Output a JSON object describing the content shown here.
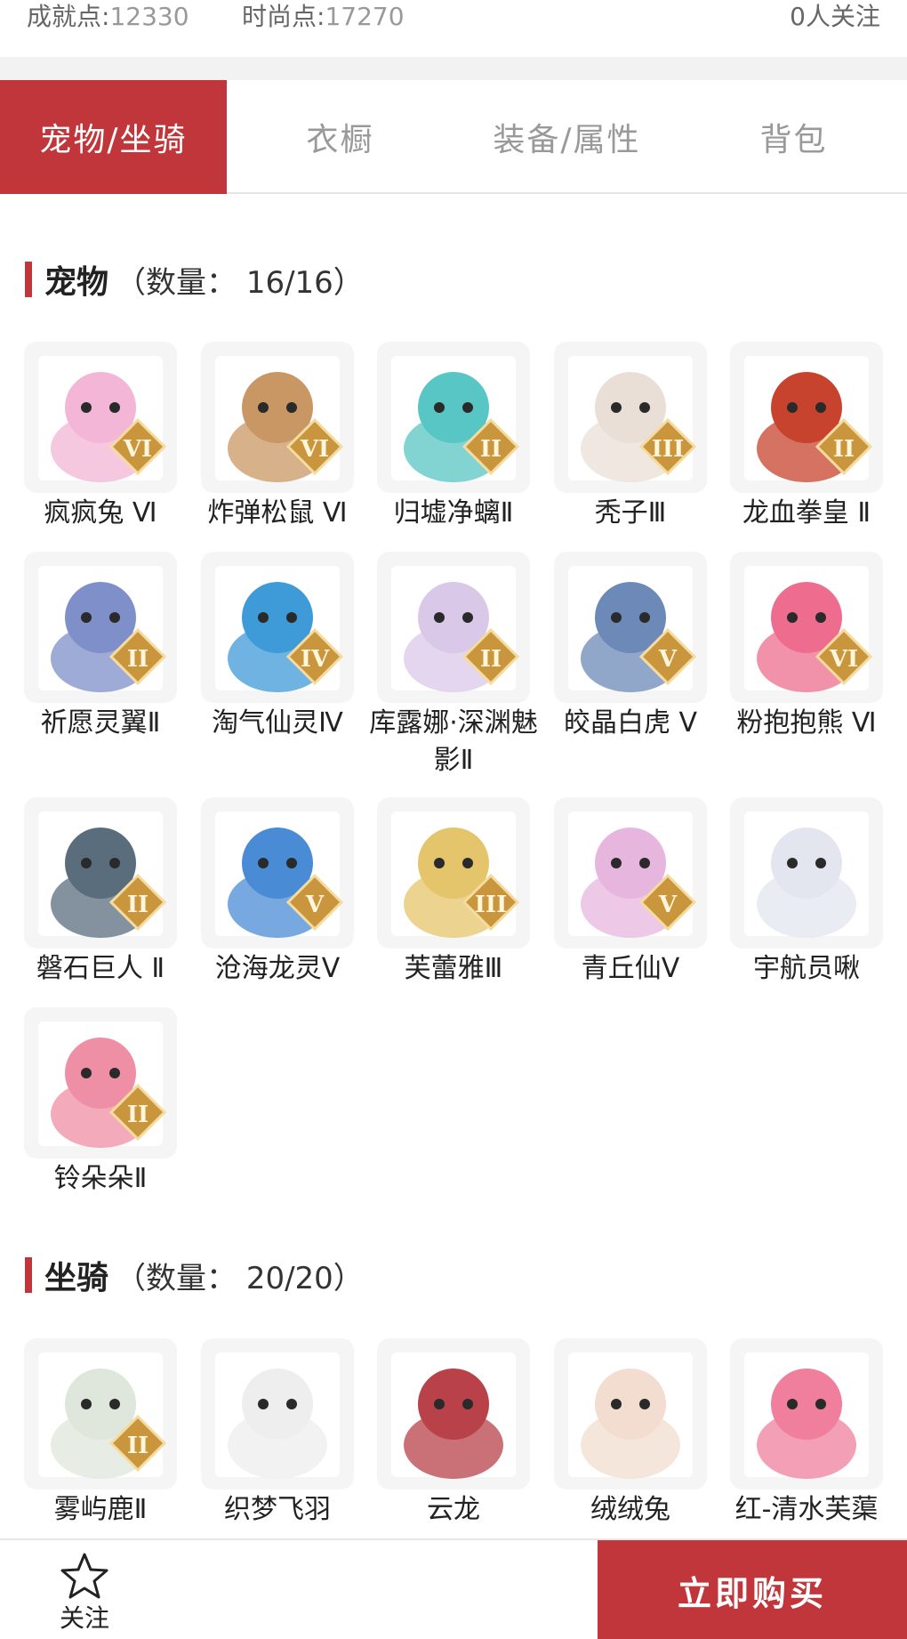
{
  "stats": {
    "achievement_label": "成就点:",
    "achievement_value": "12330",
    "fashion_label": "时尚点:",
    "fashion_value": "17270",
    "followers": "0人关注"
  },
  "tabs": [
    {
      "label": "宠物/坐骑",
      "active": true
    },
    {
      "label": "衣橱",
      "active": false
    },
    {
      "label": "装备/属性",
      "active": false
    },
    {
      "label": "背包",
      "active": false
    }
  ],
  "pets": {
    "title": "宠物",
    "count": "（数量： 16/16）",
    "items": [
      {
        "name": "疯疯兔 Ⅵ",
        "rank": "VI",
        "color": "#f3b6d6",
        "icon": "rabbit-pet-icon"
      },
      {
        "name": "炸弹松鼠 Ⅵ",
        "rank": "VI",
        "color": "#c99763",
        "icon": "squirrel-pet-icon"
      },
      {
        "name": "归墟净螭Ⅱ",
        "rank": "II",
        "color": "#58c6c4",
        "icon": "dragon-pet-icon"
      },
      {
        "name": "秃子Ⅲ",
        "rank": "III",
        "color": "#eadfd6",
        "icon": "bald-pet-icon"
      },
      {
        "name": "龙血拳皇 Ⅱ",
        "rank": "II",
        "color": "#c8432d",
        "icon": "demon-pet-icon"
      },
      {
        "name": "祈愿灵翼Ⅱ",
        "rank": "II",
        "color": "#7f8fc9",
        "icon": "griffin-pet-icon"
      },
      {
        "name": "淘气仙灵Ⅳ",
        "rank": "IV",
        "color": "#3f9ad8",
        "icon": "puppy-pet-icon"
      },
      {
        "name": "库露娜·深渊魅影Ⅱ",
        "rank": "II",
        "color": "#d9c8e8",
        "icon": "girl-pet-icon"
      },
      {
        "name": "皎晶白虎 Ⅴ",
        "rank": "V",
        "color": "#6c89b8",
        "icon": "tiger-pet-icon"
      },
      {
        "name": "粉抱抱熊 Ⅵ",
        "rank": "VI",
        "color": "#ee6d8e",
        "icon": "bear-pet-icon"
      },
      {
        "name": "磐石巨人 Ⅱ",
        "rank": "II",
        "color": "#5a6d7d",
        "icon": "golem-pet-icon"
      },
      {
        "name": "沧海龙灵Ⅴ",
        "rank": "V",
        "color": "#4a8bd6",
        "icon": "sea-dragon-pet-icon"
      },
      {
        "name": "芙蕾雅Ⅲ",
        "rank": "III",
        "color": "#e5c56b",
        "icon": "freya-pet-icon"
      },
      {
        "name": "青丘仙Ⅴ",
        "rank": "V",
        "color": "#e7b6df",
        "icon": "fox-fairy-pet-icon"
      },
      {
        "name": "宇航员啾",
        "rank": "",
        "color": "#e3e6ef",
        "icon": "astronaut-pet-icon"
      },
      {
        "name": "铃朵朵Ⅱ",
        "rank": "II",
        "color": "#ef8fa6",
        "icon": "flower-fairy-pet-icon"
      }
    ]
  },
  "mounts": {
    "title": "坐骑",
    "count": "（数量： 20/20）",
    "items": [
      {
        "name": "雾屿鹿Ⅱ",
        "rank": "II",
        "color": "#dfe6dc",
        "icon": "deer-mount-icon"
      },
      {
        "name": "织梦飞羽",
        "rank": "",
        "color": "#eeeeee",
        "icon": "feather-mount-icon"
      },
      {
        "name": "云龙",
        "rank": "",
        "color": "#b8414a",
        "icon": "cloud-dragon-mount-icon"
      },
      {
        "name": "绒绒兔",
        "rank": "",
        "color": "#f2ddd0",
        "icon": "fluffy-rabbit-mount-icon"
      },
      {
        "name": "红-清水芙蕖",
        "rank": "",
        "color": "#ef7f9c",
        "icon": "lotus-mount-icon"
      }
    ]
  },
  "bottom": {
    "follow_label": "关注",
    "buy_label": "立即购买"
  }
}
